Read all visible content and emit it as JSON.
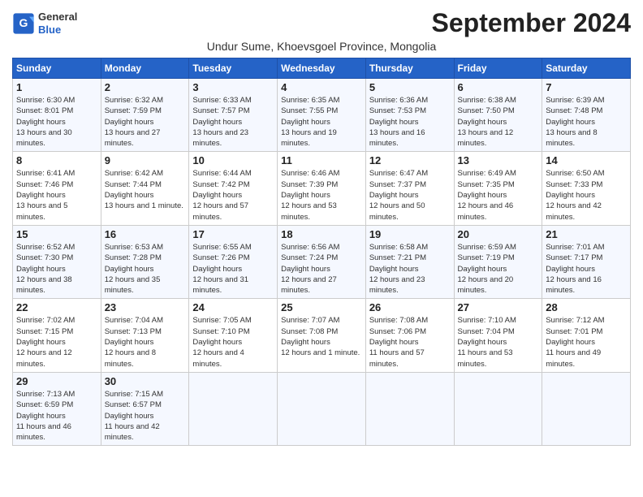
{
  "header": {
    "logo_general": "General",
    "logo_blue": "Blue",
    "title": "September 2024",
    "subtitle": "Undur Sume, Khoevsgoel Province, Mongolia"
  },
  "weekdays": [
    "Sunday",
    "Monday",
    "Tuesday",
    "Wednesday",
    "Thursday",
    "Friday",
    "Saturday"
  ],
  "weeks": [
    [
      {
        "day": "1",
        "sunrise": "6:30 AM",
        "sunset": "8:01 PM",
        "daylight": "13 hours and 30 minutes."
      },
      {
        "day": "2",
        "sunrise": "6:32 AM",
        "sunset": "7:59 PM",
        "daylight": "13 hours and 27 minutes."
      },
      {
        "day": "3",
        "sunrise": "6:33 AM",
        "sunset": "7:57 PM",
        "daylight": "13 hours and 23 minutes."
      },
      {
        "day": "4",
        "sunrise": "6:35 AM",
        "sunset": "7:55 PM",
        "daylight": "13 hours and 19 minutes."
      },
      {
        "day": "5",
        "sunrise": "6:36 AM",
        "sunset": "7:53 PM",
        "daylight": "13 hours and 16 minutes."
      },
      {
        "day": "6",
        "sunrise": "6:38 AM",
        "sunset": "7:50 PM",
        "daylight": "13 hours and 12 minutes."
      },
      {
        "day": "7",
        "sunrise": "6:39 AM",
        "sunset": "7:48 PM",
        "daylight": "13 hours and 8 minutes."
      }
    ],
    [
      {
        "day": "8",
        "sunrise": "6:41 AM",
        "sunset": "7:46 PM",
        "daylight": "13 hours and 5 minutes."
      },
      {
        "day": "9",
        "sunrise": "6:42 AM",
        "sunset": "7:44 PM",
        "daylight": "13 hours and 1 minute."
      },
      {
        "day": "10",
        "sunrise": "6:44 AM",
        "sunset": "7:42 PM",
        "daylight": "12 hours and 57 minutes."
      },
      {
        "day": "11",
        "sunrise": "6:46 AM",
        "sunset": "7:39 PM",
        "daylight": "12 hours and 53 minutes."
      },
      {
        "day": "12",
        "sunrise": "6:47 AM",
        "sunset": "7:37 PM",
        "daylight": "12 hours and 50 minutes."
      },
      {
        "day": "13",
        "sunrise": "6:49 AM",
        "sunset": "7:35 PM",
        "daylight": "12 hours and 46 minutes."
      },
      {
        "day": "14",
        "sunrise": "6:50 AM",
        "sunset": "7:33 PM",
        "daylight": "12 hours and 42 minutes."
      }
    ],
    [
      {
        "day": "15",
        "sunrise": "6:52 AM",
        "sunset": "7:30 PM",
        "daylight": "12 hours and 38 minutes."
      },
      {
        "day": "16",
        "sunrise": "6:53 AM",
        "sunset": "7:28 PM",
        "daylight": "12 hours and 35 minutes."
      },
      {
        "day": "17",
        "sunrise": "6:55 AM",
        "sunset": "7:26 PM",
        "daylight": "12 hours and 31 minutes."
      },
      {
        "day": "18",
        "sunrise": "6:56 AM",
        "sunset": "7:24 PM",
        "daylight": "12 hours and 27 minutes."
      },
      {
        "day": "19",
        "sunrise": "6:58 AM",
        "sunset": "7:21 PM",
        "daylight": "12 hours and 23 minutes."
      },
      {
        "day": "20",
        "sunrise": "6:59 AM",
        "sunset": "7:19 PM",
        "daylight": "12 hours and 20 minutes."
      },
      {
        "day": "21",
        "sunrise": "7:01 AM",
        "sunset": "7:17 PM",
        "daylight": "12 hours and 16 minutes."
      }
    ],
    [
      {
        "day": "22",
        "sunrise": "7:02 AM",
        "sunset": "7:15 PM",
        "daylight": "12 hours and 12 minutes."
      },
      {
        "day": "23",
        "sunrise": "7:04 AM",
        "sunset": "7:13 PM",
        "daylight": "12 hours and 8 minutes."
      },
      {
        "day": "24",
        "sunrise": "7:05 AM",
        "sunset": "7:10 PM",
        "daylight": "12 hours and 4 minutes."
      },
      {
        "day": "25",
        "sunrise": "7:07 AM",
        "sunset": "7:08 PM",
        "daylight": "12 hours and 1 minute."
      },
      {
        "day": "26",
        "sunrise": "7:08 AM",
        "sunset": "7:06 PM",
        "daylight": "11 hours and 57 minutes."
      },
      {
        "day": "27",
        "sunrise": "7:10 AM",
        "sunset": "7:04 PM",
        "daylight": "11 hours and 53 minutes."
      },
      {
        "day": "28",
        "sunrise": "7:12 AM",
        "sunset": "7:01 PM",
        "daylight": "11 hours and 49 minutes."
      }
    ],
    [
      {
        "day": "29",
        "sunrise": "7:13 AM",
        "sunset": "6:59 PM",
        "daylight": "11 hours and 46 minutes."
      },
      {
        "day": "30",
        "sunrise": "7:15 AM",
        "sunset": "6:57 PM",
        "daylight": "11 hours and 42 minutes."
      },
      null,
      null,
      null,
      null,
      null
    ]
  ]
}
